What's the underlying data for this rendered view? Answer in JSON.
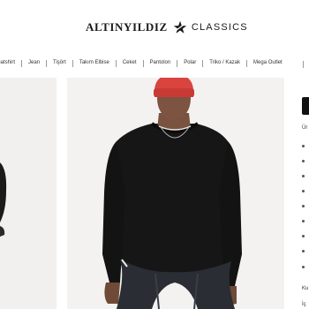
{
  "header": {
    "brand": "ALTINYILDIZ",
    "sub_brand": "CLASSICS",
    "logo_icon": "star-icon"
  },
  "nav": {
    "items": [
      "Sweatshirt",
      "Jean",
      "Tişört",
      "Takım Elbise",
      "Ceket",
      "Pantolon",
      "Polar",
      "Triko / Kazak",
      "Mega Outlet"
    ]
  },
  "panel": {
    "label_top": "Ür",
    "label_bottom_1": "Ku",
    "label_bottom_2": "İç"
  },
  "colors": {
    "beanie": "#d9443f",
    "sweatshirt": "#141414",
    "background": "#f3f2f1"
  }
}
